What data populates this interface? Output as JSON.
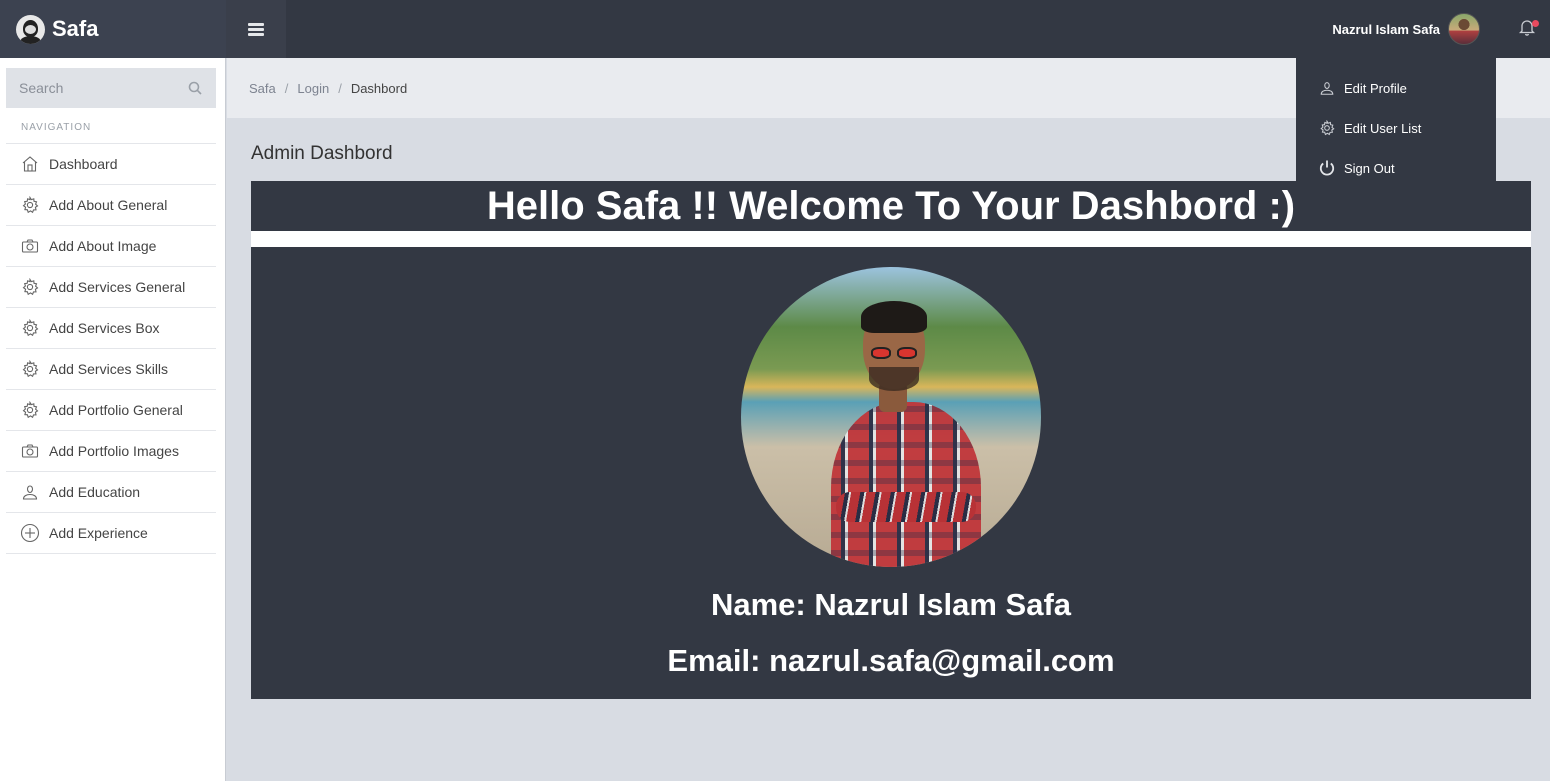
{
  "brand": {
    "name": "Safa"
  },
  "topbar": {
    "user_name": "Nazrul Islam Safa"
  },
  "search": {
    "placeholder": "Search"
  },
  "sidebar": {
    "heading": "NAVIGATION",
    "items": [
      {
        "label": "Dashboard",
        "icon": "home-icon"
      },
      {
        "label": "Add About General",
        "icon": "gear-icon"
      },
      {
        "label": "Add About Image",
        "icon": "camera-icon"
      },
      {
        "label": "Add Services General",
        "icon": "gear-icon"
      },
      {
        "label": "Add Services Box",
        "icon": "gear-icon"
      },
      {
        "label": "Add Services Skills",
        "icon": "gear-icon"
      },
      {
        "label": "Add Portfolio General",
        "icon": "gear-icon"
      },
      {
        "label": "Add Portfolio Images",
        "icon": "camera-icon"
      },
      {
        "label": "Add Education",
        "icon": "user-icon"
      },
      {
        "label": "Add Experience",
        "icon": "plus-circle-icon"
      }
    ]
  },
  "breadcrumb": [
    "Safa",
    "Login",
    "Dashbord"
  ],
  "main": {
    "title": "Admin Dashbord",
    "welcome": "Hello Safa !! Welcome To Your Dashbord :)",
    "name_line": "Name: Nazrul Islam Safa",
    "email_line": "Email: nazrul.safa@gmail.com"
  },
  "dropdown": {
    "items": [
      {
        "label": "Edit Profile",
        "icon": "user-icon"
      },
      {
        "label": "Edit User List",
        "icon": "gear-icon"
      },
      {
        "label": "Sign Out",
        "icon": "power-icon"
      }
    ]
  },
  "colors": {
    "topbar": "#333843",
    "brand_bg": "#3c4250",
    "content_bg": "#d8dce3",
    "notification_dot": "#e84a5f"
  }
}
